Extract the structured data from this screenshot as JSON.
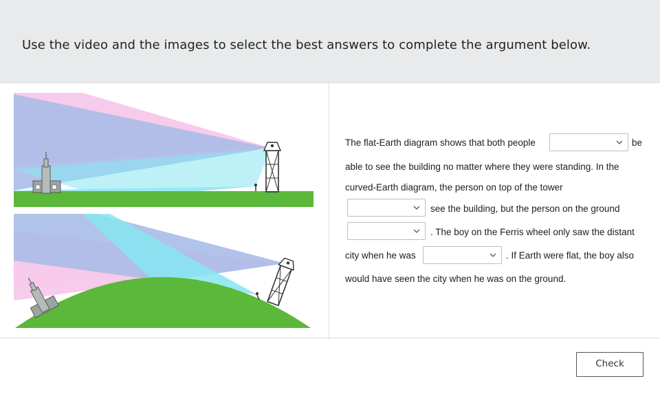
{
  "header": {
    "instruction": "Use the video and the images to select the best answers to complete the argument below."
  },
  "argument": {
    "line1_text": "The flat-Earth diagram shows that both people",
    "line1_after": "be",
    "line2_text": "able to see the building no matter where they were standing. In the",
    "line3_text": "curved-Earth diagram, the person on top of the tower",
    "line4_after": "see the building, but the person on the ground",
    "line5_after": ". The boy on the Ferris wheel only saw the distant",
    "line6_before": "city when he was",
    "line6_after": ". If Earth were flat, the boy also",
    "line7_text": "would have seen the city when he was on the ground.",
    "dropdowns": [
      {
        "selected": ""
      },
      {
        "selected": ""
      },
      {
        "selected": ""
      },
      {
        "selected": ""
      }
    ]
  },
  "actions": {
    "check_label": "Check"
  },
  "colors": {
    "header_bg": "#e9eaeb",
    "ground_green": "#5bb83a",
    "sight_pink": "#f7c8ea",
    "sight_blue": "#aabde8",
    "sight_cyan": "#86e6f0"
  },
  "icons": {
    "dropdown": "chevron-down-icon"
  }
}
